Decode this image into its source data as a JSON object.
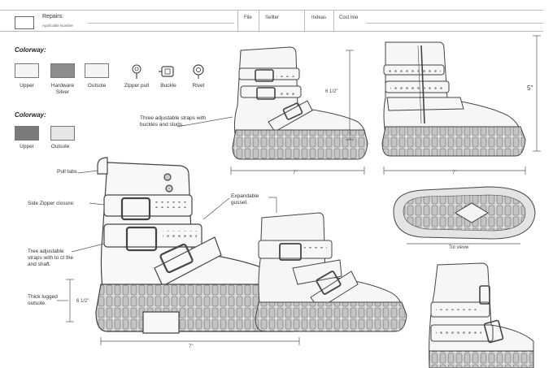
{
  "header": {
    "title": "Repairs:",
    "subtitle": "Applicable Number",
    "cells": [
      "File",
      "Sellter",
      "Indeas",
      "Cost line"
    ]
  },
  "colorway_primary": {
    "title": "Colorway:",
    "swatches": [
      {
        "label": "Upper",
        "color": "#f4f4f4"
      },
      {
        "label": "Hardware Silver",
        "color": "#8c8c8c"
      },
      {
        "label": "Outsole",
        "color": "#f4f4f4"
      }
    ],
    "hardware": [
      {
        "label": "Zipper pull",
        "icon": "zipper-pull-icon"
      },
      {
        "label": "Buckle",
        "icon": "buckle-icon"
      },
      {
        "label": "Rivet",
        "icon": "rivet-icon"
      }
    ]
  },
  "colorway_secondary": {
    "title": "Colorway:",
    "swatches": [
      {
        "label": "Upper",
        "color": "#7a7a7a"
      },
      {
        "label": "Outsole",
        "color": "#e6e6e6"
      }
    ]
  },
  "callouts": {
    "straps_top": "Three adjustable straps with buckles and studs.",
    "pull_tabs": "Pull tabs",
    "zipper": "Side Zipper closure:",
    "expandable": "Expandable gusset.",
    "straps_bottom": "Tree adjustable straps with to ct the and shaft.",
    "outsole": "Thick lugged outsole."
  },
  "dimensions": {
    "shaft_height_side": "6 1/2\"",
    "shaft_height_back": "5\"",
    "length_side": "7\"",
    "length_back": "7\"",
    "shaft_height_main": "6 1/2\"",
    "length_main": "7\"",
    "bottom_view": "Tol vievw"
  }
}
